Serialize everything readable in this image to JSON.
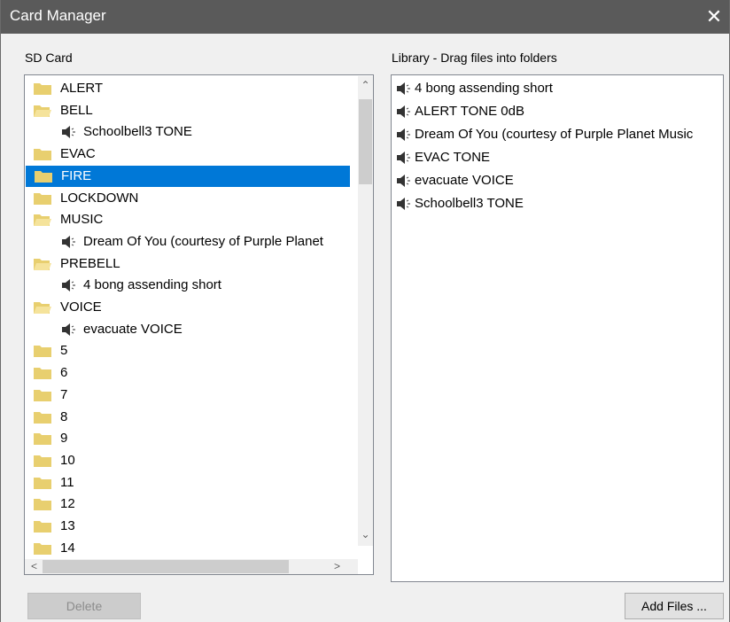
{
  "window": {
    "title": "Card Manager",
    "close_glyph": "✕"
  },
  "sd": {
    "label": "SD Card",
    "items": [
      {
        "type": "folder",
        "label": "ALERT"
      },
      {
        "type": "folder-open",
        "label": "BELL"
      },
      {
        "type": "file",
        "label": "Schoolbell3 TONE"
      },
      {
        "type": "folder",
        "label": "EVAC"
      },
      {
        "type": "folder",
        "label": "FIRE",
        "selected": true
      },
      {
        "type": "folder",
        "label": "LOCKDOWN"
      },
      {
        "type": "folder-open",
        "label": "MUSIC"
      },
      {
        "type": "file",
        "label": "Dream Of You (courtesy of Purple Planet"
      },
      {
        "type": "folder-open",
        "label": "PREBELL"
      },
      {
        "type": "file",
        "label": "4 bong assending short"
      },
      {
        "type": "folder-open",
        "label": "VOICE"
      },
      {
        "type": "file",
        "label": "evacuate VOICE"
      },
      {
        "type": "folder",
        "label": "5"
      },
      {
        "type": "folder",
        "label": "6"
      },
      {
        "type": "folder",
        "label": "7"
      },
      {
        "type": "folder",
        "label": "8"
      },
      {
        "type": "folder",
        "label": "9"
      },
      {
        "type": "folder",
        "label": "10"
      },
      {
        "type": "folder",
        "label": "11"
      },
      {
        "type": "folder",
        "label": "12"
      },
      {
        "type": "folder",
        "label": "13"
      },
      {
        "type": "folder",
        "label": "14"
      }
    ]
  },
  "library": {
    "label": "Library - Drag files into folders",
    "items": [
      "4 bong assending short",
      "ALERT TONE 0dB",
      "Dream Of You (courtesy of Purple Planet Music",
      "EVAC TONE",
      "evacuate VOICE",
      "Schoolbell3 TONE"
    ]
  },
  "buttons": {
    "delete": "Delete",
    "add_files": "Add Files ..."
  },
  "colors": {
    "selection": "#0078d7",
    "folder": "#e8cf6f",
    "titlebar": "#5a5a5a"
  },
  "icons": {
    "folder": "folder-icon",
    "folder_open": "folder-open-icon",
    "file": "speaker-icon"
  }
}
